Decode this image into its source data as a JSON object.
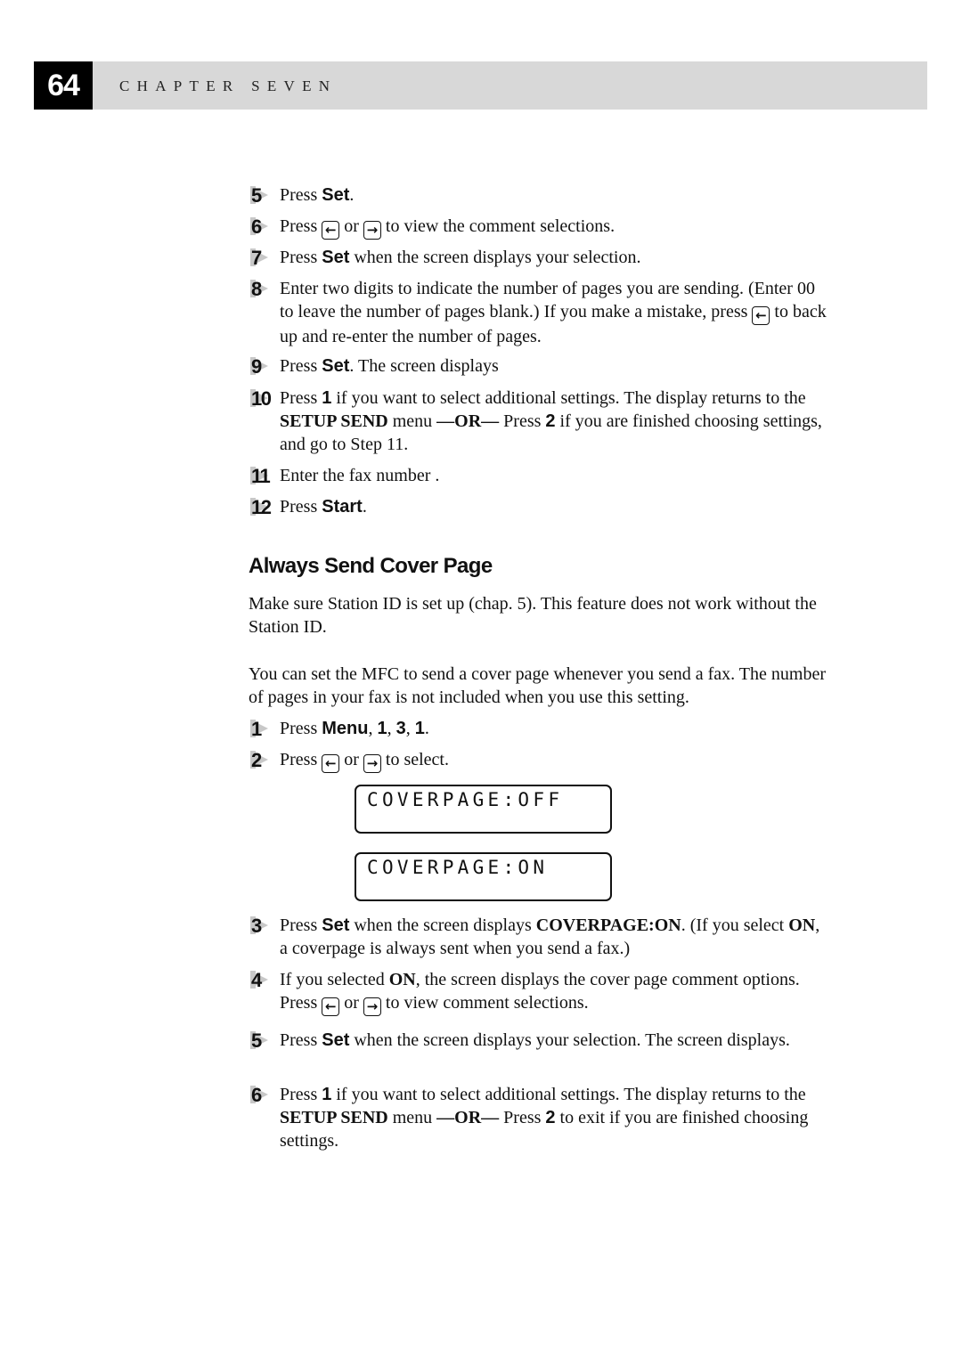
{
  "header": {
    "page_number": "64",
    "chapter": "CHAPTER SEVEN"
  },
  "steps_a": [
    {
      "num": "5",
      "parts": [
        [
          "t",
          "Press "
        ],
        [
          "bs",
          "Set"
        ],
        [
          "t",
          "."
        ]
      ]
    },
    {
      "num": "6",
      "parts": [
        [
          "t",
          "Press "
        ],
        [
          "key",
          "left-arrow"
        ],
        [
          "t",
          " or "
        ],
        [
          "key",
          "right-arrow"
        ],
        [
          "t",
          " to view the comment selections."
        ]
      ]
    },
    {
      "num": "7",
      "parts": [
        [
          "t",
          "Press "
        ],
        [
          "bs",
          "Set"
        ],
        [
          "t",
          " when the screen displays your selection."
        ]
      ]
    },
    {
      "num": "8",
      "parts": [
        [
          "t",
          "Enter two digits to indicate the number of pages you are sending. (Enter 00 to leave the number of pages blank.) If you make a mistake, press "
        ],
        [
          "key",
          "left-arrow"
        ],
        [
          "t",
          " to back up and re-enter the number of pages."
        ]
      ]
    },
    {
      "num": "9",
      "parts": [
        [
          "t",
          "Press "
        ],
        [
          "bs",
          "Set"
        ],
        [
          "t",
          ". The screen displays"
        ]
      ]
    },
    {
      "num": "10",
      "parts": [
        [
          "t",
          "Press "
        ],
        [
          "bs",
          "1"
        ],
        [
          "t",
          " if you want to select additional settings. The display returns to the "
        ],
        [
          "b",
          "SETUP SEND"
        ],
        [
          "t",
          " menu "
        ],
        [
          "b",
          "—OR—"
        ],
        [
          "t",
          " Press "
        ],
        [
          "bs",
          "2"
        ],
        [
          "t",
          " if you are finished choosing settings, and go to Step 11."
        ]
      ]
    },
    {
      "num": "11",
      "parts": [
        [
          "t",
          "Enter the fax number ."
        ]
      ]
    },
    {
      "num": "12",
      "parts": [
        [
          "t",
          "Press "
        ],
        [
          "bs",
          "Start"
        ],
        [
          "t",
          "."
        ]
      ]
    }
  ],
  "section": {
    "heading": "Always Send Cover Page",
    "para1": "Make sure Station ID is set up (chap. 5). This feature does not work without the Station ID.",
    "para2": "You can set the MFC to send a cover page whenever you send a fax. The number of pages in your fax is not included when you use this setting."
  },
  "steps_b1": [
    {
      "num": "1",
      "parts": [
        [
          "t",
          "Press "
        ],
        [
          "bs",
          "Menu"
        ],
        [
          "t",
          ", "
        ],
        [
          "bs",
          "1"
        ],
        [
          "t",
          ", "
        ],
        [
          "bs",
          "3"
        ],
        [
          "t",
          ", "
        ],
        [
          "bs",
          "1"
        ],
        [
          "t",
          "."
        ]
      ]
    },
    {
      "num": "2",
      "parts": [
        [
          "t",
          "Press "
        ],
        [
          "key",
          "left-arrow"
        ],
        [
          "t",
          " or "
        ],
        [
          "key",
          "right-arrow"
        ],
        [
          "t",
          " to select."
        ]
      ]
    }
  ],
  "lcd": {
    "display_1": "COVERPAGE:OFF",
    "display_2": "COVERPAGE:ON"
  },
  "steps_b2": [
    {
      "num": "3",
      "parts": [
        [
          "t",
          "Press "
        ],
        [
          "bs",
          "Set"
        ],
        [
          "t",
          " when the screen displays "
        ],
        [
          "b",
          "COVERPAGE:ON"
        ],
        [
          "t",
          ". (If you select "
        ],
        [
          "b",
          "ON"
        ],
        [
          "t",
          ", a coverpage is always sent when you send a fax.)"
        ]
      ]
    },
    {
      "num": "4",
      "parts": [
        [
          "t",
          "If you selected "
        ],
        [
          "b",
          "ON"
        ],
        [
          "t",
          ", the screen displays the cover page comment options. Press "
        ],
        [
          "key",
          "left-arrow"
        ],
        [
          "t",
          " or "
        ],
        [
          "key",
          "right-arrow"
        ],
        [
          "t",
          " to view comment selections."
        ]
      ]
    },
    {
      "num": "5",
      "parts": [
        [
          "t",
          "Press "
        ],
        [
          "bs",
          "Set"
        ],
        [
          "t",
          " when the screen displays your selection. The screen displays."
        ]
      ]
    },
    {
      "num": "6",
      "parts": [
        [
          "t",
          "Press "
        ],
        [
          "bs",
          "1"
        ],
        [
          "t",
          " if you want to select additional settings. The display returns to the "
        ],
        [
          "b",
          "SETUP SEND"
        ],
        [
          "t",
          " menu "
        ],
        [
          "b",
          "—OR—"
        ],
        [
          "t",
          " Press "
        ],
        [
          "bs",
          "2"
        ],
        [
          "t",
          " to exit if you are finished choosing settings."
        ]
      ]
    }
  ],
  "icons": {
    "left-arrow": "←",
    "right-arrow": "→"
  }
}
